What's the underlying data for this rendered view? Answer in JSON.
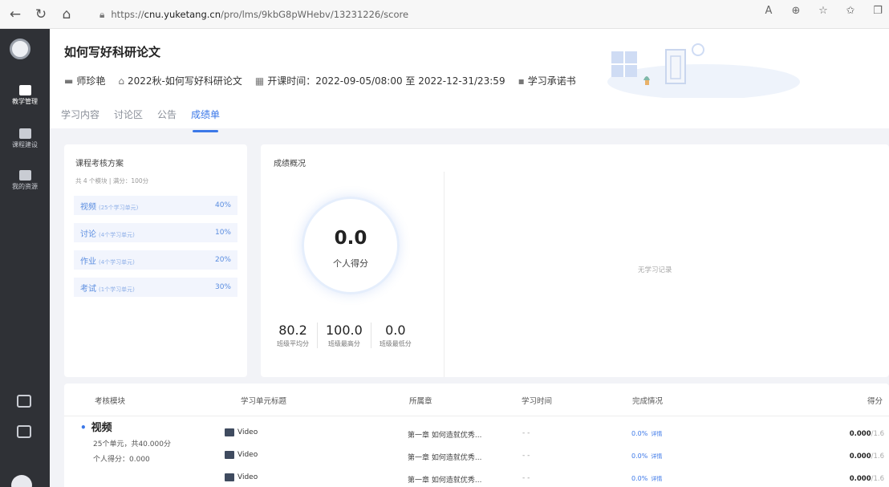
{
  "browser": {
    "url_prefix": "https://",
    "url_host": "cnu.yuketang.cn",
    "url_path": "/pro/lms/9kbG8pWHebv/13231226/score"
  },
  "sidebar": {
    "items": [
      {
        "label": "教学管理"
      },
      {
        "label": "课程建设"
      },
      {
        "label": "我的资源"
      }
    ]
  },
  "header": {
    "title": "如何写好科研论文",
    "teacher": "师珍艳",
    "class": "2022秋-如何写好科研论文",
    "time_label": "开课时间：",
    "time_value": "2022-09-05/08:00 至 2022-12-31/23:59",
    "pledge": "学习承诺书",
    "tabs": [
      "学习内容",
      "讨论区",
      "公告",
      "成绩单"
    ]
  },
  "plan": {
    "title": "课程考核方案",
    "subtitle": "共 4 个模块 | 满分：100分",
    "rows": [
      {
        "name": "视频",
        "units": "(25个学习单元)",
        "pct": "40%"
      },
      {
        "name": "讨论",
        "units": "(4个学习单元)",
        "pct": "10%"
      },
      {
        "name": "作业",
        "units": "(4个学习单元)",
        "pct": "20%"
      },
      {
        "name": "考试",
        "units": "(1个学习单元)",
        "pct": "30%"
      }
    ]
  },
  "overview": {
    "title": "成绩概况",
    "score": "0.0",
    "score_label": "个人得分",
    "stats": [
      {
        "value": "80.2",
        "label": "班级平均分"
      },
      {
        "value": "100.0",
        "label": "班级最高分"
      },
      {
        "value": "0.0",
        "label": "班级最低分"
      }
    ],
    "no_record": "无学习记录"
  },
  "table": {
    "headers": [
      "考核模块",
      "学习单元标题",
      "所属章",
      "学习时间",
      "完成情况",
      "得分"
    ],
    "module": {
      "name": "视频",
      "summary": "25个单元，共40.000分",
      "personal": "个人得分：0.000"
    },
    "rows": [
      {
        "unit": "Video",
        "chapter": "第一章 如何造就优秀...",
        "time": "- -",
        "done": "0.0%",
        "detail": "详情",
        "score": "0.000",
        "total": "/1.6"
      },
      {
        "unit": "Video",
        "chapter": "第一章 如何造就优秀...",
        "time": "- -",
        "done": "0.0%",
        "detail": "详情",
        "score": "0.000",
        "total": "/1.6"
      },
      {
        "unit": "Video",
        "chapter": "第一章 如何造就优秀...",
        "time": "- -",
        "done": "0.0%",
        "detail": "详情",
        "score": "0.000",
        "total": "/1.6"
      }
    ]
  }
}
